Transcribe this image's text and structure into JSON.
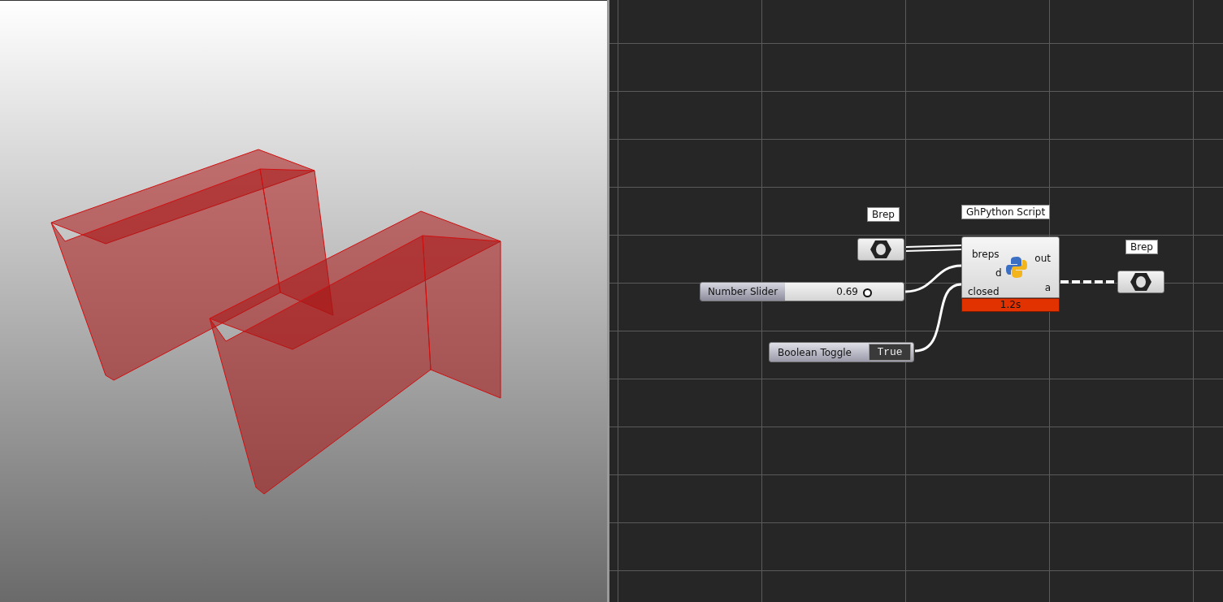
{
  "brep_params": [
    {
      "tag": "Brep"
    },
    {
      "tag": "Brep"
    }
  ],
  "script": {
    "title": "GhPython Script",
    "inputs": [
      "breps",
      "d",
      "closed"
    ],
    "outputs": [
      "out",
      "a"
    ],
    "timing": "1.2s"
  },
  "slider": {
    "name": "Number Slider",
    "value": "0.69",
    "level": 0.69
  },
  "toggle": {
    "name": "Boolean Toggle",
    "value": "True"
  }
}
